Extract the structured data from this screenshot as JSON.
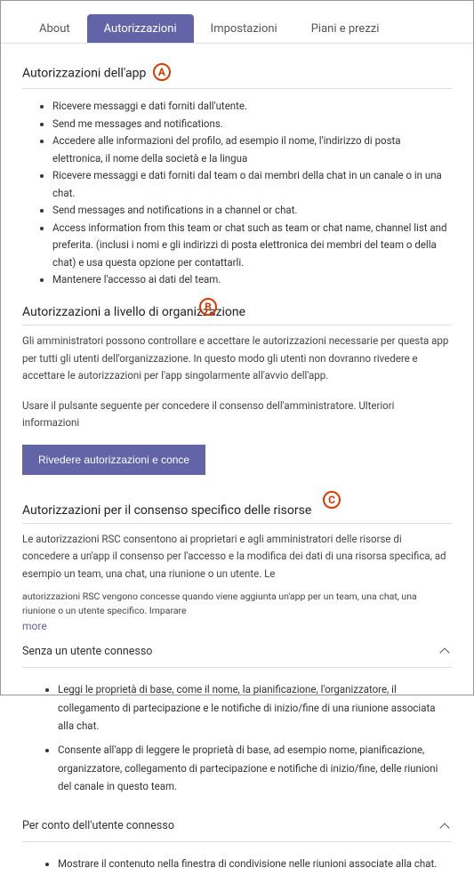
{
  "tabs": {
    "about": "About",
    "permissions": "Autorizzazioni",
    "settings": "Impostazioni",
    "plans": "Piani e prezzi"
  },
  "callouts": {
    "a": "A",
    "b": "B",
    "c": "C"
  },
  "section_app": {
    "title": "Autorizzazioni dell'app",
    "items": [
      "Ricevere messaggi e dati forniti dall'utente.",
      "Send me messages and notifications.",
      "Accedere alle informazioni del profilo, ad esempio il nome, l'indirizzo di posta elettronica, il nome della società e la lingua",
      "Ricevere messaggi e dati forniti dal team o dai membri della chat in un canale o in una chat.",
      "Send messages and notifications in a channel or chat.",
      "Access information from this team or chat such as team or chat name, channel list and preferita. (inclusi i nomi e gli indirizzi di posta elettronica dei membri del team o della chat) e usa questa opzione per contattarli.",
      "Mantenere l'accesso ai dati del team."
    ]
  },
  "section_org": {
    "title": "Autorizzazioni a livello di organizzazione",
    "body1": "Gli amministratori possono controllare e accettare le autorizzazioni necessarie per questa app per tutti gli utenti dell'organizzazione. In questo modo gli utenti non dovranno rivedere e accettare le autorizzazioni per l'app singolarmente all'avvio dell'app.",
    "body2": "Usare il pulsante seguente per concedere il consenso dell'amministratore. Ulteriori informazioni",
    "button": "Rivedere autorizzazioni e conce"
  },
  "section_rsc": {
    "title": "Autorizzazioni per il consenso specifico delle risorse",
    "body": "Le autorizzazioni RSC consentono ai proprietari e agli amministratori delle risorse di concedere a un'app il consenso per l'accesso e la modifica dei dati di una risorsa specifica, ad esempio un team, una chat, una riunione o un utente. Le",
    "body_small": "autorizzazioni RSC vengono concesse quando viene aggiunta un'app per un team, una chat, una riunione o un utente specifico. Imparare",
    "more": "more"
  },
  "expander1": {
    "title": "Senza un utente connesso",
    "items": [
      "Leggi le proprietà di base, come il nome, la pianificazione, l'organizzatore, il collegamento di partecipazione e le notifiche di inizio/fine di una riunione associata alla chat.",
      "Consente all'app di leggere le proprietà di base, ad esempio nome, pianificazione, organizzatore, collegamento di partecipazione e notifiche di inizio/fine, delle riunioni del canale in questo team."
    ]
  },
  "expander2": {
    "title": "Per conto dell'utente connesso",
    "items": [
      "Mostrare il contenuto nella finestra di condivisione nelle riunioni associate alla chat."
    ]
  }
}
